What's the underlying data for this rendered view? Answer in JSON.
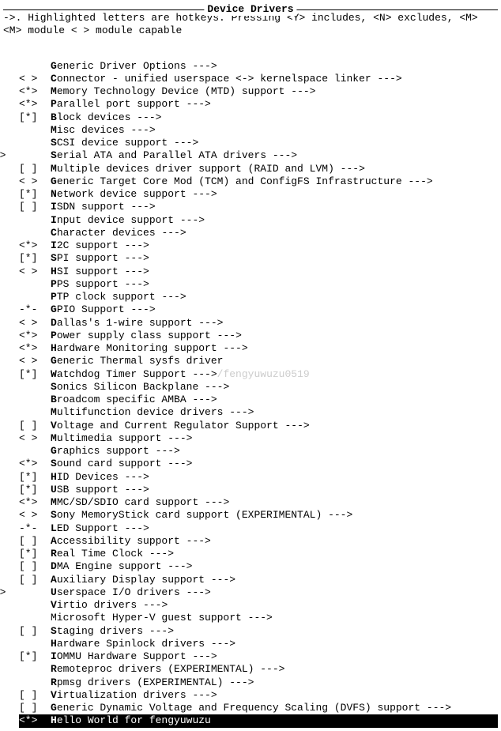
{
  "title": "Device Drivers",
  "help_line1_a": "->.  Highlighted letters are hotkeys.  Pressing ",
  "help_line1_b": " includes, ",
  "help_line1_c": " excludes, ",
  "help_line2_a": " module  ",
  "help_line2_b": " module capable",
  "key_y": "<Y>",
  "key_n": "<N>",
  "key_m": "<M>",
  "lt_gt": "< >",
  "arrow": "  --->",
  "watermark": "/fengyuwuzu0519",
  "items": [
    {
      "prefix": "",
      "hot": "G",
      "rest": "eneric Driver Options",
      "arrow": true
    },
    {
      "prefix": "< >",
      "hot": "C",
      "rest": "onnector - unified userspace <-> kernelspace linker",
      "arrow": true
    },
    {
      "prefix": "<*>",
      "hot": "M",
      "rest": "emory Technology Device (MTD) support",
      "arrow": true
    },
    {
      "prefix": "<*>",
      "hot": "P",
      "rest": "arallel port support",
      "arrow": true
    },
    {
      "prefix": "[*]",
      "hot": "B",
      "rest": "lock devices",
      "arrow": true
    },
    {
      "prefix": "",
      "hot": "M",
      "rest": "isc devices",
      "arrow": true
    },
    {
      "prefix": "",
      "hot": "S",
      "rest": "CSI device support",
      "arrow": true
    },
    {
      "prefix": "< >",
      "hot": "S",
      "rest": "erial ATA and Parallel ATA drivers",
      "arrow": true,
      "outdent": true
    },
    {
      "prefix": "[ ]",
      "hot": "M",
      "rest": "ultiple devices driver support (RAID and LVM)",
      "arrow": true
    },
    {
      "prefix": "< >",
      "hot": "G",
      "rest": "eneric Target Core Mod (TCM) and ConfigFS Infrastructure",
      "arrow": true
    },
    {
      "prefix": "[*]",
      "hot": "N",
      "rest": "etwork device support",
      "arrow": true
    },
    {
      "prefix": "[ ]",
      "hot": "I",
      "rest": "SDN support",
      "arrow": true
    },
    {
      "prefix": "",
      "hot": "I",
      "rest": "nput device support",
      "arrow": true
    },
    {
      "prefix": "",
      "hot": "C",
      "rest": "haracter devices",
      "arrow": true
    },
    {
      "prefix": "<*>",
      "hot": "I",
      "rest": "2C support",
      "arrow": true
    },
    {
      "prefix": "[*]",
      "hot": "S",
      "rest": "PI support",
      "arrow": true
    },
    {
      "prefix": "< >",
      "hot": "H",
      "rest": "SI support",
      "arrow": true
    },
    {
      "prefix": "",
      "hot": "P",
      "rest": "PS support",
      "arrow": true
    },
    {
      "prefix": "",
      "hot": "P",
      "rest": "TP clock support",
      "arrow": true
    },
    {
      "prefix": "-*-",
      "hot": "G",
      "rest": "PIO Support",
      "arrow": true
    },
    {
      "prefix": "< >",
      "hot": "D",
      "rest": "allas's 1-wire support",
      "arrow": true
    },
    {
      "prefix": "<*>",
      "hot": "P",
      "rest": "ower supply class support",
      "arrow": true
    },
    {
      "prefix": "<*>",
      "hot": "H",
      "rest": "ardware Monitoring support",
      "arrow": true
    },
    {
      "prefix": "< >",
      "hot": "G",
      "rest": "eneric Thermal sysfs driver",
      "arrow": false
    },
    {
      "prefix": "[*]",
      "hot": "W",
      "rest": "atchdog Timer Support",
      "arrow": true,
      "watermark": true
    },
    {
      "prefix": "",
      "hot": "S",
      "rest": "onics Silicon Backplane",
      "arrow": true
    },
    {
      "prefix": "",
      "hot": "B",
      "rest": "roadcom specific AMBA",
      "arrow": true
    },
    {
      "prefix": "",
      "hot": "M",
      "rest": "ultifunction device drivers",
      "arrow": true
    },
    {
      "prefix": "[ ]",
      "hot": "V",
      "rest": "oltage and Current Regulator Support",
      "arrow": true
    },
    {
      "prefix": "< >",
      "hot": "M",
      "rest": "ultimedia support",
      "arrow": true
    },
    {
      "prefix": "",
      "hot": "G",
      "rest": "raphics support",
      "arrow": true
    },
    {
      "prefix": "<*>",
      "hot": "S",
      "rest": "ound card support",
      "arrow": true
    },
    {
      "prefix": "[*]",
      "hot": "H",
      "rest": "ID Devices",
      "arrow": true
    },
    {
      "prefix": "[*]",
      "hot": "U",
      "rest": "SB support",
      "arrow": true
    },
    {
      "prefix": "<*>",
      "hot": "M",
      "rest": "MC/SD/SDIO card support",
      "arrow": true
    },
    {
      "prefix": "< >",
      "hot": "S",
      "rest": "ony MemoryStick card support (EXPERIMENTAL)",
      "arrow": true
    },
    {
      "prefix": "-*-",
      "hot": "L",
      "rest": "ED Support",
      "arrow": true
    },
    {
      "prefix": "[ ]",
      "hot": "A",
      "rest": "ccessibility support",
      "arrow": true
    },
    {
      "prefix": "[*]",
      "hot": "R",
      "rest": "eal Time Clock",
      "arrow": true
    },
    {
      "prefix": "[ ]",
      "hot": "D",
      "rest": "MA Engine support",
      "arrow": true
    },
    {
      "prefix": "[ ]",
      "hot": "A",
      "rest": "uxiliary Display support",
      "arrow": true
    },
    {
      "prefix": "< >",
      "hot": "U",
      "rest": "serspace I/O drivers",
      "arrow": true,
      "outdent": true
    },
    {
      "prefix": "",
      "hot": "V",
      "rest": "irtio drivers",
      "arrow": true
    },
    {
      "prefix": "",
      "hot": "",
      "rest": "Microsoft Hyper-V guest support",
      "arrow": true
    },
    {
      "prefix": "[ ]",
      "hot": "S",
      "rest": "taging drivers",
      "arrow": true
    },
    {
      "prefix": "",
      "hot": "H",
      "rest": "ardware Spinlock drivers",
      "arrow": true
    },
    {
      "prefix": "[*]",
      "hot": "I",
      "rest": "OMMU Hardware Support",
      "arrow": true
    },
    {
      "prefix": "",
      "hot": "R",
      "rest": "emoteproc drivers (EXPERIMENTAL)",
      "arrow": true
    },
    {
      "prefix": "",
      "hot": "R",
      "rest": "pmsg drivers (EXPERIMENTAL)",
      "arrow": true
    },
    {
      "prefix": "[ ]",
      "hot": "V",
      "rest": "irtualization drivers",
      "arrow": true
    },
    {
      "prefix": "[ ]",
      "hot": "G",
      "rest": "eneric Dynamic Voltage and Frequency Scaling (DVFS) support",
      "arrow": true
    },
    {
      "prefix": "<*>",
      "hot": "H",
      "rest": "ello World for fengyuwuzu",
      "arrow": false,
      "selected": true
    }
  ]
}
